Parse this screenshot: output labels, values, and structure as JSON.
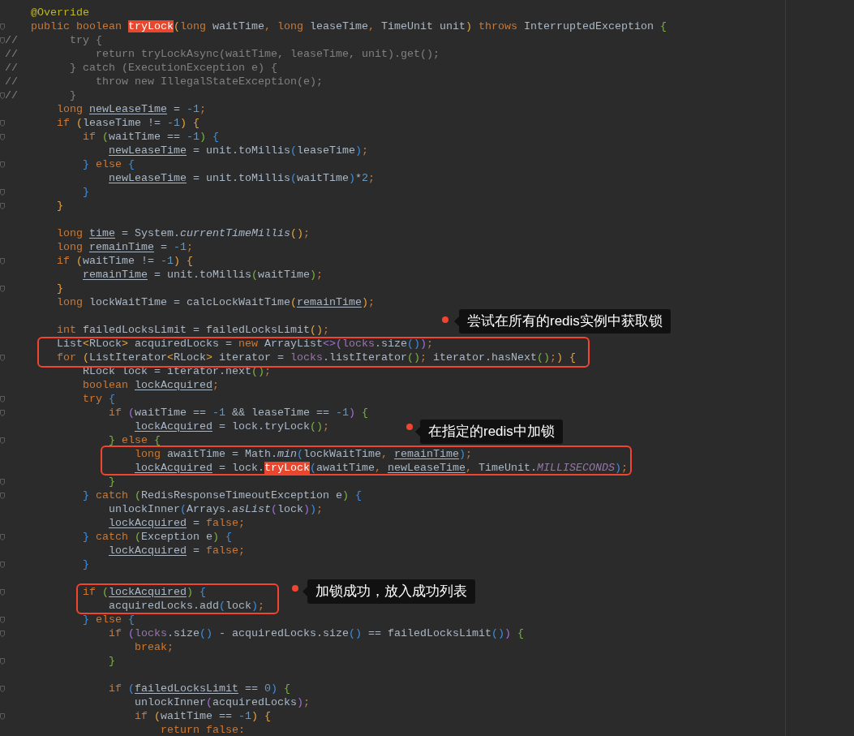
{
  "editor": {
    "lines": [
      {
        "fold": false,
        "s": [
          {
            "text": "    @Override",
            "kind": "annotation"
          }
        ]
      },
      {
        "fold": true,
        "s": [
          {
            "text": "    public boolean ",
            "kind": "keyword"
          },
          {
            "text": "tryLock",
            "kind": "match"
          },
          {
            "text": "(",
            "kind": "b1"
          },
          {
            "text": "long ",
            "kind": "keyword"
          },
          {
            "text": "waitTime",
            "kind": "plain"
          },
          {
            "text": ", long ",
            "kind": "keyword"
          },
          {
            "text": "leaseTime",
            "kind": "plain"
          },
          {
            "text": ", ",
            "kind": "keyword"
          },
          {
            "text": "TimeUnit unit",
            "kind": "plain"
          },
          {
            "text": ")",
            "kind": "b1"
          },
          {
            "text": " throws ",
            "kind": "keyword"
          },
          {
            "text": "InterruptedException ",
            "kind": "plain"
          },
          {
            "text": "{",
            "kind": "b2"
          }
        ]
      },
      {
        "fold": true,
        "s": [
          {
            "text": "//        try {",
            "kind": "comment"
          }
        ]
      },
      {
        "fold": false,
        "s": [
          {
            "text": "//            return tryLockAsync(waitTime, leaseTime, unit).get();",
            "kind": "comment"
          }
        ]
      },
      {
        "fold": false,
        "s": [
          {
            "text": "//        } catch (ExecutionException e) {",
            "kind": "comment"
          }
        ]
      },
      {
        "fold": false,
        "s": [
          {
            "text": "//            throw new IllegalStateException(e);",
            "kind": "comment"
          }
        ]
      },
      {
        "fold": true,
        "s": [
          {
            "text": "//        }",
            "kind": "comment"
          }
        ]
      },
      {
        "fold": false,
        "s": [
          {
            "text": "        long ",
            "kind": "keyword"
          },
          {
            "text": "newLeaseTime",
            "kind": "var"
          },
          {
            "text": " = ",
            "kind": "plain"
          },
          {
            "text": "-1",
            "kind": "number"
          },
          {
            "text": ";",
            "kind": "keyword"
          }
        ]
      },
      {
        "fold": true,
        "s": [
          {
            "text": "        if ",
            "kind": "keyword"
          },
          {
            "text": "(",
            "kind": "b1"
          },
          {
            "text": "leaseTime != ",
            "kind": "plain"
          },
          {
            "text": "-1",
            "kind": "number"
          },
          {
            "text": ")",
            "kind": "b1"
          },
          {
            "text": " {",
            "kind": "b1"
          }
        ]
      },
      {
        "fold": true,
        "s": [
          {
            "text": "            if ",
            "kind": "keyword"
          },
          {
            "text": "(",
            "kind": "b2"
          },
          {
            "text": "waitTime == ",
            "kind": "plain"
          },
          {
            "text": "-1",
            "kind": "number"
          },
          {
            "text": ")",
            "kind": "b2"
          },
          {
            "text": " {",
            "kind": "b3"
          }
        ]
      },
      {
        "fold": false,
        "s": [
          {
            "text": "                newLeaseTime",
            "kind": "var"
          },
          {
            "text": " = unit.toMillis",
            "kind": "plain"
          },
          {
            "text": "(",
            "kind": "b3"
          },
          {
            "text": "leaseTime",
            "kind": "plain"
          },
          {
            "text": ")",
            "kind": "b3"
          },
          {
            "text": ";",
            "kind": "keyword"
          }
        ]
      },
      {
        "fold": true,
        "s": [
          {
            "text": "            }",
            "kind": "b3"
          },
          {
            "text": " else ",
            "kind": "keyword"
          },
          {
            "text": "{",
            "kind": "b3"
          }
        ]
      },
      {
        "fold": false,
        "s": [
          {
            "text": "                newLeaseTime",
            "kind": "var"
          },
          {
            "text": " = unit.toMillis",
            "kind": "plain"
          },
          {
            "text": "(",
            "kind": "b3"
          },
          {
            "text": "waitTime",
            "kind": "plain"
          },
          {
            "text": ")",
            "kind": "b3"
          },
          {
            "text": "*",
            "kind": "plain"
          },
          {
            "text": "2",
            "kind": "number"
          },
          {
            "text": ";",
            "kind": "keyword"
          }
        ]
      },
      {
        "fold": true,
        "s": [
          {
            "text": "            }",
            "kind": "b3"
          }
        ]
      },
      {
        "fold": true,
        "s": [
          {
            "text": "        }",
            "kind": "b1"
          }
        ]
      },
      {
        "fold": false
      },
      {
        "fold": false,
        "s": [
          {
            "text": "        long ",
            "kind": "keyword"
          },
          {
            "text": "time",
            "kind": "var"
          },
          {
            "text": " = System.",
            "kind": "plain"
          },
          {
            "text": "currentTimeMillis",
            "kind": "italic"
          },
          {
            "text": "()",
            "kind": "b1"
          },
          {
            "text": ";",
            "kind": "keyword"
          }
        ]
      },
      {
        "fold": false,
        "s": [
          {
            "text": "        long ",
            "kind": "keyword"
          },
          {
            "text": "remainTime",
            "kind": "var"
          },
          {
            "text": " = ",
            "kind": "plain"
          },
          {
            "text": "-1",
            "kind": "number"
          },
          {
            "text": ";",
            "kind": "keyword"
          }
        ]
      },
      {
        "fold": true,
        "s": [
          {
            "text": "        if ",
            "kind": "keyword"
          },
          {
            "text": "(",
            "kind": "b1"
          },
          {
            "text": "waitTime != ",
            "kind": "plain"
          },
          {
            "text": "-1",
            "kind": "number"
          },
          {
            "text": ")",
            "kind": "b1"
          },
          {
            "text": " {",
            "kind": "b1"
          }
        ]
      },
      {
        "fold": false,
        "s": [
          {
            "text": "            remainTime",
            "kind": "var"
          },
          {
            "text": " = unit.toMillis",
            "kind": "plain"
          },
          {
            "text": "(",
            "kind": "b2"
          },
          {
            "text": "waitTime",
            "kind": "plain"
          },
          {
            "text": ")",
            "kind": "b2"
          },
          {
            "text": ";",
            "kind": "keyword"
          }
        ]
      },
      {
        "fold": true,
        "s": [
          {
            "text": "        }",
            "kind": "b1"
          }
        ]
      },
      {
        "fold": false,
        "s": [
          {
            "text": "        long ",
            "kind": "keyword"
          },
          {
            "text": "lockWaitTime = calcLockWaitTime",
            "kind": "plain"
          },
          {
            "text": "(",
            "kind": "b1"
          },
          {
            "text": "remainTime",
            "kind": "var"
          },
          {
            "text": ")",
            "kind": "b1"
          },
          {
            "text": ";",
            "kind": "keyword"
          }
        ]
      },
      {
        "fold": false
      },
      {
        "fold": false,
        "s": [
          {
            "text": "        int ",
            "kind": "keyword"
          },
          {
            "text": "failedLocksLimit = failedLocksLimit",
            "kind": "plain"
          },
          {
            "text": "()",
            "kind": "b1"
          },
          {
            "text": ";",
            "kind": "keyword"
          }
        ]
      },
      {
        "fold": false,
        "s": [
          {
            "text": "        List",
            "kind": "plain"
          },
          {
            "text": "<",
            "kind": "b1"
          },
          {
            "text": "RLock",
            "kind": "plain"
          },
          {
            "text": ">",
            "kind": "b1"
          },
          {
            "text": " acquiredLocks = ",
            "kind": "plain"
          },
          {
            "text": "new ",
            "kind": "keyword"
          },
          {
            "text": "ArrayList",
            "kind": "plain"
          },
          {
            "text": "<>(",
            "kind": "b4"
          },
          {
            "text": "locks",
            "kind": "field"
          },
          {
            "text": ".size",
            "kind": "plain"
          },
          {
            "text": "()",
            "kind": "b3"
          },
          {
            "text": ")",
            "kind": "b4"
          },
          {
            "text": ";",
            "kind": "keyword"
          }
        ]
      },
      {
        "fold": true,
        "s": [
          {
            "text": "        for ",
            "kind": "keyword"
          },
          {
            "text": "(",
            "kind": "b1"
          },
          {
            "text": "ListIterator",
            "kind": "plain"
          },
          {
            "text": "<",
            "kind": "b1"
          },
          {
            "text": "RLock",
            "kind": "plain"
          },
          {
            "text": ">",
            "kind": "b1"
          },
          {
            "text": " iterator = ",
            "kind": "plain"
          },
          {
            "text": "locks",
            "kind": "field"
          },
          {
            "text": ".listIterator",
            "kind": "plain"
          },
          {
            "text": "()",
            "kind": "b2"
          },
          {
            "text": "; ",
            "kind": "keyword"
          },
          {
            "text": "iterator.hasNext",
            "kind": "plain"
          },
          {
            "text": "()",
            "kind": "b2"
          },
          {
            "text": ";",
            "kind": "keyword"
          },
          {
            "text": ")",
            "kind": "b1"
          },
          {
            "text": " {",
            "kind": "b1"
          }
        ]
      },
      {
        "fold": false,
        "s": [
          {
            "text": "            RLock lock = iterator.next",
            "kind": "plain"
          },
          {
            "text": "()",
            "kind": "b2"
          },
          {
            "text": ";",
            "kind": "keyword"
          }
        ]
      },
      {
        "fold": false,
        "s": [
          {
            "text": "            boolean ",
            "kind": "keyword"
          },
          {
            "text": "lockAcquired",
            "kind": "var"
          },
          {
            "text": ";",
            "kind": "keyword"
          }
        ]
      },
      {
        "fold": true,
        "s": [
          {
            "text": "            try ",
            "kind": "keyword"
          },
          {
            "text": "{",
            "kind": "b3"
          }
        ]
      },
      {
        "fold": true,
        "s": [
          {
            "text": "                if ",
            "kind": "keyword"
          },
          {
            "text": "(",
            "kind": "b4"
          },
          {
            "text": "waitTime == ",
            "kind": "plain"
          },
          {
            "text": "-1",
            "kind": "number"
          },
          {
            "text": " && leaseTime == ",
            "kind": "plain"
          },
          {
            "text": "-1",
            "kind": "number"
          },
          {
            "text": ")",
            "kind": "b4"
          },
          {
            "text": " {",
            "kind": "b2"
          }
        ]
      },
      {
        "fold": false,
        "s": [
          {
            "text": "                    lockAcquired",
            "kind": "var"
          },
          {
            "text": " = lock.tryLock",
            "kind": "plain"
          },
          {
            "text": "()",
            "kind": "b2"
          },
          {
            "text": ";",
            "kind": "keyword"
          }
        ]
      },
      {
        "fold": true,
        "s": [
          {
            "text": "                }",
            "kind": "b2"
          },
          {
            "text": " else ",
            "kind": "keyword"
          },
          {
            "text": "{",
            "kind": "b2"
          }
        ]
      },
      {
        "fold": false,
        "s": [
          {
            "text": "                    long ",
            "kind": "keyword"
          },
          {
            "text": "awaitTime = Math.",
            "kind": "plain"
          },
          {
            "text": "min",
            "kind": "italic"
          },
          {
            "text": "(",
            "kind": "b3"
          },
          {
            "text": "lockWaitTime",
            "kind": "plain"
          },
          {
            "text": ", ",
            "kind": "keyword"
          },
          {
            "text": "remainTime",
            "kind": "var"
          },
          {
            "text": ")",
            "kind": "b3"
          },
          {
            "text": ";",
            "kind": "keyword"
          }
        ]
      },
      {
        "fold": false,
        "s": [
          {
            "text": "                    lockAcquired",
            "kind": "var"
          },
          {
            "text": " = lock.",
            "kind": "plain"
          },
          {
            "text": "tryLock",
            "kind": "match"
          },
          {
            "text": "(",
            "kind": "b3"
          },
          {
            "text": "awaitTime",
            "kind": "plain"
          },
          {
            "text": ", ",
            "kind": "keyword"
          },
          {
            "text": "newLeaseTime",
            "kind": "var"
          },
          {
            "text": ", ",
            "kind": "keyword"
          },
          {
            "text": "TimeUnit.",
            "kind": "plain"
          },
          {
            "text": "MILLISECONDS",
            "kind": "constant"
          },
          {
            "text": ")",
            "kind": "b3"
          },
          {
            "text": ";",
            "kind": "keyword"
          }
        ]
      },
      {
        "fold": true,
        "s": [
          {
            "text": "                }",
            "kind": "b2"
          }
        ]
      },
      {
        "fold": true,
        "s": [
          {
            "text": "            }",
            "kind": "b3"
          },
          {
            "text": " catch ",
            "kind": "keyword"
          },
          {
            "text": "(",
            "kind": "b2"
          },
          {
            "text": "RedisResponseTimeoutException e",
            "kind": "plain"
          },
          {
            "text": ")",
            "kind": "b2"
          },
          {
            "text": " {",
            "kind": "b3"
          }
        ]
      },
      {
        "fold": false,
        "s": [
          {
            "text": "                unlockInner",
            "kind": "plain"
          },
          {
            "text": "(",
            "kind": "b3"
          },
          {
            "text": "Arrays.",
            "kind": "plain"
          },
          {
            "text": "asList",
            "kind": "italic"
          },
          {
            "text": "(",
            "kind": "b4"
          },
          {
            "text": "lock",
            "kind": "plain"
          },
          {
            "text": ")",
            "kind": "b4"
          },
          {
            "text": ")",
            "kind": "b3"
          },
          {
            "text": ";",
            "kind": "keyword"
          }
        ]
      },
      {
        "fold": false,
        "s": [
          {
            "text": "                lockAcquired",
            "kind": "var"
          },
          {
            "text": " = ",
            "kind": "plain"
          },
          {
            "text": "false;",
            "kind": "keyword"
          }
        ]
      },
      {
        "fold": true,
        "s": [
          {
            "text": "            }",
            "kind": "b3"
          },
          {
            "text": " catch ",
            "kind": "keyword"
          },
          {
            "text": "(",
            "kind": "b2"
          },
          {
            "text": "Exception e",
            "kind": "plain"
          },
          {
            "text": ")",
            "kind": "b2"
          },
          {
            "text": " {",
            "kind": "b3"
          }
        ]
      },
      {
        "fold": false,
        "s": [
          {
            "text": "                lockAcquired",
            "kind": "var"
          },
          {
            "text": " = ",
            "kind": "plain"
          },
          {
            "text": "false;",
            "kind": "keyword"
          }
        ]
      },
      {
        "fold": true,
        "s": [
          {
            "text": "            }",
            "kind": "b3"
          }
        ]
      },
      {
        "fold": false
      },
      {
        "fold": true,
        "s": [
          {
            "text": "            if ",
            "kind": "keyword"
          },
          {
            "text": "(",
            "kind": "b2"
          },
          {
            "text": "lockAcquired",
            "kind": "var"
          },
          {
            "text": ")",
            "kind": "b2"
          },
          {
            "text": " {",
            "kind": "b3"
          }
        ]
      },
      {
        "fold": false,
        "s": [
          {
            "text": "                acquiredLocks.add",
            "kind": "plain"
          },
          {
            "text": "(",
            "kind": "b3"
          },
          {
            "text": "lock",
            "kind": "plain"
          },
          {
            "text": ")",
            "kind": "b3"
          },
          {
            "text": ";",
            "kind": "keyword"
          }
        ]
      },
      {
        "fold": true,
        "s": [
          {
            "text": "            }",
            "kind": "b3"
          },
          {
            "text": " else ",
            "kind": "keyword"
          },
          {
            "text": "{",
            "kind": "b3"
          }
        ]
      },
      {
        "fold": true,
        "s": [
          {
            "text": "                if ",
            "kind": "keyword"
          },
          {
            "text": "(",
            "kind": "b4"
          },
          {
            "text": "locks",
            "kind": "field"
          },
          {
            "text": ".size",
            "kind": "plain"
          },
          {
            "text": "()",
            "kind": "b3"
          },
          {
            "text": " - acquiredLocks.size",
            "kind": "plain"
          },
          {
            "text": "()",
            "kind": "b3"
          },
          {
            "text": " == failedLocksLimit",
            "kind": "plain"
          },
          {
            "text": "()",
            "kind": "b3"
          },
          {
            "text": ")",
            "kind": "b4"
          },
          {
            "text": " {",
            "kind": "b2"
          }
        ]
      },
      {
        "fold": false,
        "s": [
          {
            "text": "                    break;",
            "kind": "keyword"
          }
        ]
      },
      {
        "fold": true,
        "s": [
          {
            "text": "                }",
            "kind": "b2"
          }
        ]
      },
      {
        "fold": false
      },
      {
        "fold": true,
        "s": [
          {
            "text": "                if ",
            "kind": "keyword"
          },
          {
            "text": "(",
            "kind": "b3"
          },
          {
            "text": "failedLocksLimit",
            "kind": "var"
          },
          {
            "text": " == ",
            "kind": "plain"
          },
          {
            "text": "0",
            "kind": "number"
          },
          {
            "text": ")",
            "kind": "b3"
          },
          {
            "text": " {",
            "kind": "b2"
          }
        ]
      },
      {
        "fold": false,
        "s": [
          {
            "text": "                    unlockInner",
            "kind": "plain"
          },
          {
            "text": "(",
            "kind": "b4"
          },
          {
            "text": "acquiredLocks",
            "kind": "plain"
          },
          {
            "text": ")",
            "kind": "b4"
          },
          {
            "text": ";",
            "kind": "keyword"
          }
        ]
      },
      {
        "fold": true,
        "s": [
          {
            "text": "                    if ",
            "kind": "keyword"
          },
          {
            "text": "(",
            "kind": "b1"
          },
          {
            "text": "waitTime == ",
            "kind": "plain"
          },
          {
            "text": "-1",
            "kind": "number"
          },
          {
            "text": ")",
            "kind": "b1"
          },
          {
            "text": " {",
            "kind": "b1"
          }
        ]
      },
      {
        "fold": false,
        "s": [
          {
            "text": "                        return false:",
            "kind": "keyword"
          }
        ]
      }
    ]
  },
  "annotations": [
    {
      "label": "尝试在所有的redis实例中获取锁"
    },
    {
      "label": "在指定的redis中加锁"
    },
    {
      "label": "加锁成功，放入成功列表"
    }
  ]
}
